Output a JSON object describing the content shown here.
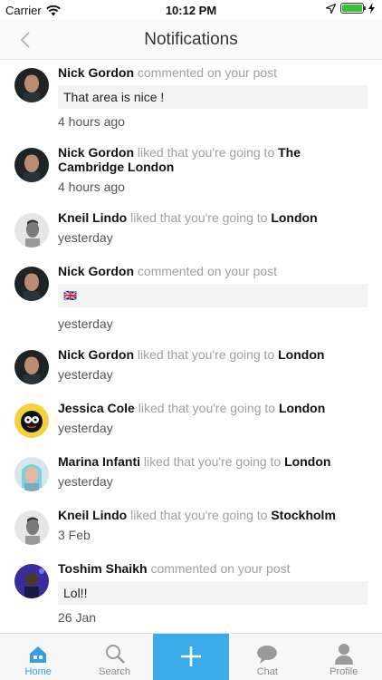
{
  "status_bar": {
    "carrier": "Carrier",
    "time": "10:12 PM"
  },
  "nav": {
    "title": "Notifications"
  },
  "colors": {
    "accent": "#3aaae8",
    "active_tab": "#3a9ee6",
    "muted": "#a0a0a0"
  },
  "notifications": [
    {
      "name": "Nick Gordon",
      "action": "commented on your post",
      "target": "",
      "comment": "That area is nice !",
      "time": "4 hours ago",
      "avatar": "photo"
    },
    {
      "name": "Nick Gordon",
      "action": "liked that you're going to",
      "target": "The Cambridge London",
      "comment": "",
      "time": "4 hours ago",
      "avatar": "photo"
    },
    {
      "name": "Kneil Lindo",
      "action": "liked that you're going to",
      "target": "London",
      "comment": "",
      "time": "yesterday",
      "avatar": "photo"
    },
    {
      "name": "Nick Gordon",
      "action": "commented on your post",
      "target": "",
      "comment": "🇬🇧",
      "time": "yesterday",
      "avatar": "photo"
    },
    {
      "name": "Nick Gordon",
      "action": "liked that you're going to",
      "target": "London",
      "comment": "",
      "time": "yesterday",
      "avatar": "photo"
    },
    {
      "name": "Jessica Cole",
      "action": "liked that you're going to",
      "target": "London",
      "comment": "",
      "time": "yesterday",
      "avatar": "photo"
    },
    {
      "name": "Marina Infanti",
      "action": "liked that you're going to",
      "target": "London",
      "comment": "",
      "time": "yesterday",
      "avatar": "photo"
    },
    {
      "name": "Kneil Lindo",
      "action": "liked that you're going to",
      "target": "Stockholm",
      "comment": "",
      "time": "3 Feb",
      "avatar": "photo"
    },
    {
      "name": "Toshim Shaikh",
      "action": "commented on your post",
      "target": "",
      "comment": "Lol!!",
      "time": "26 Jan",
      "avatar": "photo"
    }
  ],
  "tabs": [
    {
      "label": "Home",
      "icon": "home-icon",
      "active": true
    },
    {
      "label": "Search",
      "icon": "search-icon",
      "active": false
    },
    {
      "label": "",
      "icon": "plus-icon",
      "active": false
    },
    {
      "label": "Chat",
      "icon": "chat-icon",
      "active": false
    },
    {
      "label": "Profile",
      "icon": "profile-icon",
      "active": false
    }
  ]
}
